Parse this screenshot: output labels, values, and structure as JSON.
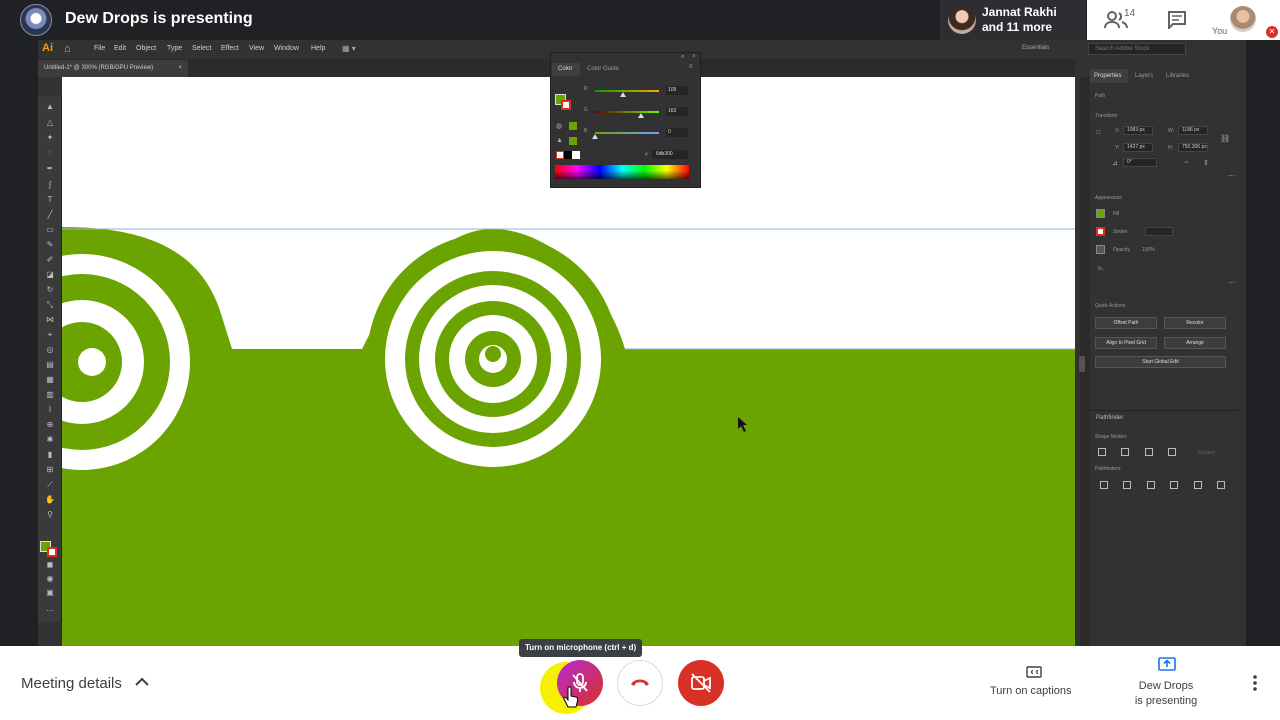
{
  "meet": {
    "presenting_title": "Dew Drops is presenting",
    "participants_line1": "Jannat Rakhi",
    "participants_line2": "and 11 more",
    "people_count": "14",
    "you_label": "You",
    "meeting_details": "Meeting details",
    "mic_tooltip": "Turn on microphone (ctrl + d)",
    "captions_label": "Turn on captions",
    "present_label_1": "Dew Drops",
    "present_label_2": "is presenting",
    "colors": {
      "mic_off": "#d93025",
      "accent": "#1a73e8",
      "highlight": "#f6f100"
    }
  },
  "illustrator": {
    "logo": "Ai",
    "menu": [
      "File",
      "Edit",
      "Object",
      "Type",
      "Select",
      "Effect",
      "View",
      "Window",
      "Help"
    ],
    "workspace": "Essentials",
    "stock_search_placeholder": "Search Adobe Stock",
    "doc_tab": "Untitled-1* @ 300% (RGB/GPU Preview)",
    "color_panel": {
      "tabs": [
        "Color",
        "Color Guide"
      ],
      "channels": [
        {
          "label": "R",
          "value": "109"
        },
        {
          "label": "G",
          "value": "163"
        },
        {
          "label": "B",
          "value": "0"
        }
      ],
      "hex_prefix": "#",
      "hex": "6db300"
    },
    "properties": {
      "tabs": [
        "Properties",
        "Layers",
        "Libraries"
      ],
      "object_type": "Path",
      "transform_title": "Transform",
      "x_label": "X:",
      "x": "1083 px",
      "y_label": "Y:",
      "y": "1437 px",
      "w_label": "W:",
      "w": "1186 px",
      "h_label": "H:",
      "h": "750.306 px",
      "rotate": "0°",
      "appearance_title": "Appearance",
      "fill_label": "Fill",
      "stroke_label": "Stroke",
      "opacity_label": "Opacity",
      "opacity": "100%",
      "fx_label": "fx.",
      "quick_actions_title": "Quick Actions",
      "quick_actions": [
        "Offset Path",
        "Recolor",
        "Align to Pixel Grid",
        "Arrange",
        "Start Global Edit"
      ],
      "fill_color": "#6ba300"
    },
    "pathfinder": {
      "title": "Pathfinder",
      "shape_modes": "Shape Modes:",
      "expand": "Expand",
      "pathfinders": "Pathfinders:"
    },
    "artwork_color": "#6ba300"
  }
}
